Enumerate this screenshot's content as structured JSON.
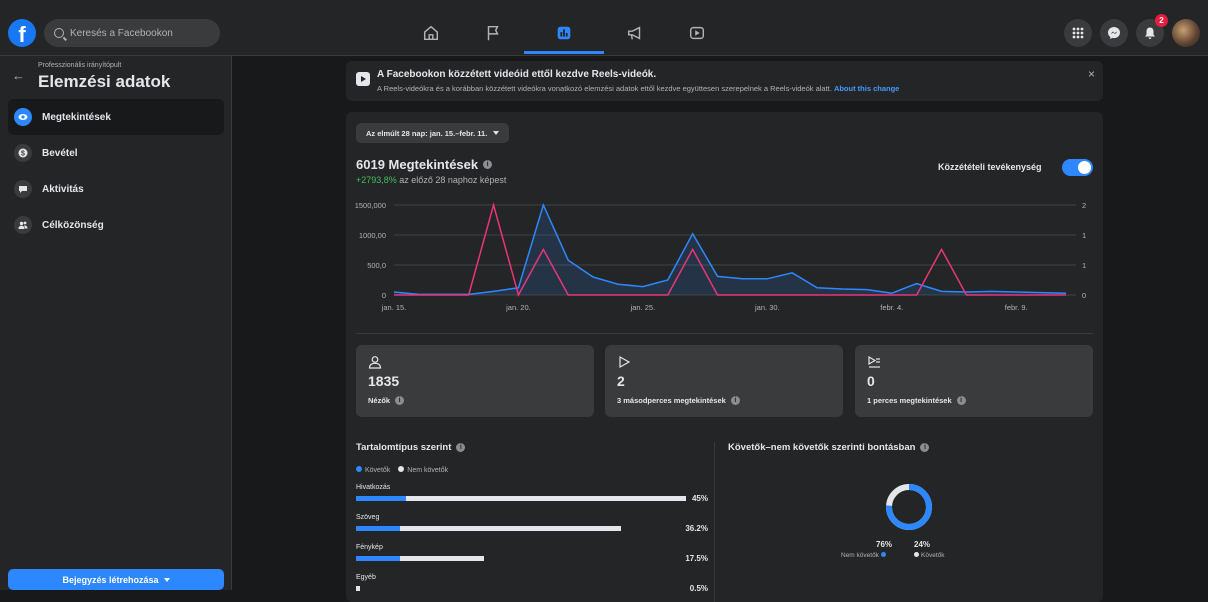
{
  "topbar": {
    "search_placeholder": "Keresés a Facebookon",
    "notification_count": "2"
  },
  "sidebar": {
    "subtitle": "Professzionális irányítópult",
    "title": "Elemzési adatok",
    "items": [
      {
        "label": "Megtekintések"
      },
      {
        "label": "Bevétel"
      },
      {
        "label": "Aktivitás"
      },
      {
        "label": "Célközönség"
      }
    ],
    "create_button": "Bejegyzés létrehozása"
  },
  "notice": {
    "title": "A Facebookon közzétett videóid ettől kezdve Reels-videók.",
    "text": "A Reels-videókra és a korábban közzétett videókra vonatkozó elemzési adatok ettől kezdve együttesen szerepelnek a Reels-videók alatt.",
    "link": "About this change",
    "close": "×"
  },
  "range": {
    "label": "Az elmúlt 28 nap: jan. 15.–febr. 11."
  },
  "views": {
    "title": "6019 Megtekintések",
    "delta_pct": "+2793,8%",
    "delta_text": " az előző 28 naphoz képest"
  },
  "toggle": {
    "label": "Közzétételi tevékenység",
    "on": true
  },
  "chart_data": {
    "type": "line",
    "x_tick_labels": [
      "jan. 15.",
      "jan. 20.",
      "jan. 25.",
      "jan. 30.",
      "febr. 4.",
      "febr. 9."
    ],
    "y_left_ticks": [
      "1500,000",
      "1000,00",
      "500,0",
      "0"
    ],
    "y_right_ticks": [
      "2",
      "1",
      "1",
      "0"
    ],
    "ylim": [
      0,
      1500
    ],
    "series": [
      {
        "color": "#2d88ff",
        "values": [
          50,
          10,
          10,
          10,
          60,
          120,
          1500,
          580,
          300,
          180,
          140,
          250,
          1020,
          310,
          270,
          270,
          370,
          120,
          100,
          90,
          30,
          190,
          60,
          50,
          60,
          50,
          40,
          30
        ]
      },
      {
        "color": "#e8357a",
        "values": [
          0,
          0,
          0,
          0,
          1500,
          0,
          760,
          0,
          0,
          0,
          0,
          0,
          760,
          0,
          0,
          0,
          0,
          0,
          0,
          0,
          0,
          0,
          760,
          0,
          0,
          0,
          0,
          0
        ]
      }
    ]
  },
  "stats": [
    {
      "value": "1835",
      "label": "Nézők"
    },
    {
      "value": "2",
      "label": "3 másodperces megtekintések"
    },
    {
      "value": "0",
      "label": "1 perces megtekintések"
    }
  ],
  "content_type": {
    "title": "Tartalomtípus szerint",
    "legend": [
      "Követők",
      "Nem követők"
    ],
    "rows": [
      {
        "label": "Hivatkozás",
        "value": "45%",
        "total": 45,
        "followers": 9
      },
      {
        "label": "Szöveg",
        "value": "36.2%",
        "total": 36.2,
        "followers": 8
      },
      {
        "label": "Fénykép",
        "value": "17.5%",
        "total": 17.5,
        "followers": 8
      },
      {
        "label": "Egyéb",
        "value": "0.5%",
        "total": 0.5,
        "followers": 0
      }
    ]
  },
  "followers_split": {
    "title": "Követők–nem követők szerinti bontásban",
    "non_followers_pct": "76%",
    "followers_pct": "24%",
    "non_followers_label": "Nem követők",
    "followers_label": "Követők",
    "non_followers_value": 76,
    "followers_value": 24
  }
}
